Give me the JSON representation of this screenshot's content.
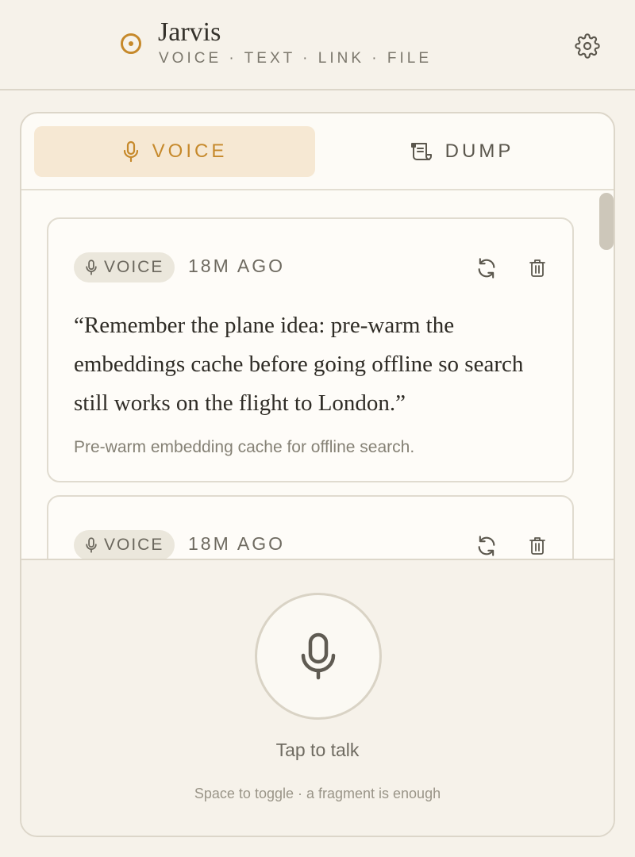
{
  "app": {
    "title": "Jarvis",
    "subtitle": "VOICE · TEXT · LINK · FILE",
    "logo_icon": "target-circle-icon",
    "settings_icon": "gear-icon"
  },
  "tabs": [
    {
      "label": "VOICE",
      "icon": "microphone-icon",
      "active": true
    },
    {
      "label": "DUMP",
      "icon": "scroll-icon",
      "active": false
    }
  ],
  "entries": [
    {
      "badge": "VOICE",
      "time": "18M AGO",
      "quote": "“Remember the plane idea: pre-warm the embeddings cache before going offline so search still works on the flight to London.”",
      "summary": "Pre-warm embedding cache for offline search."
    },
    {
      "badge": "VOICE",
      "time": "18M AGO"
    }
  ],
  "recorder": {
    "label": "Tap to talk",
    "hint": "Space to toggle · a fragment is enough",
    "icon": "microphone-icon"
  },
  "colors": {
    "accent": "#c6892b",
    "background": "#f6f2ea",
    "active_tab_bg": "#f6e8d3"
  }
}
